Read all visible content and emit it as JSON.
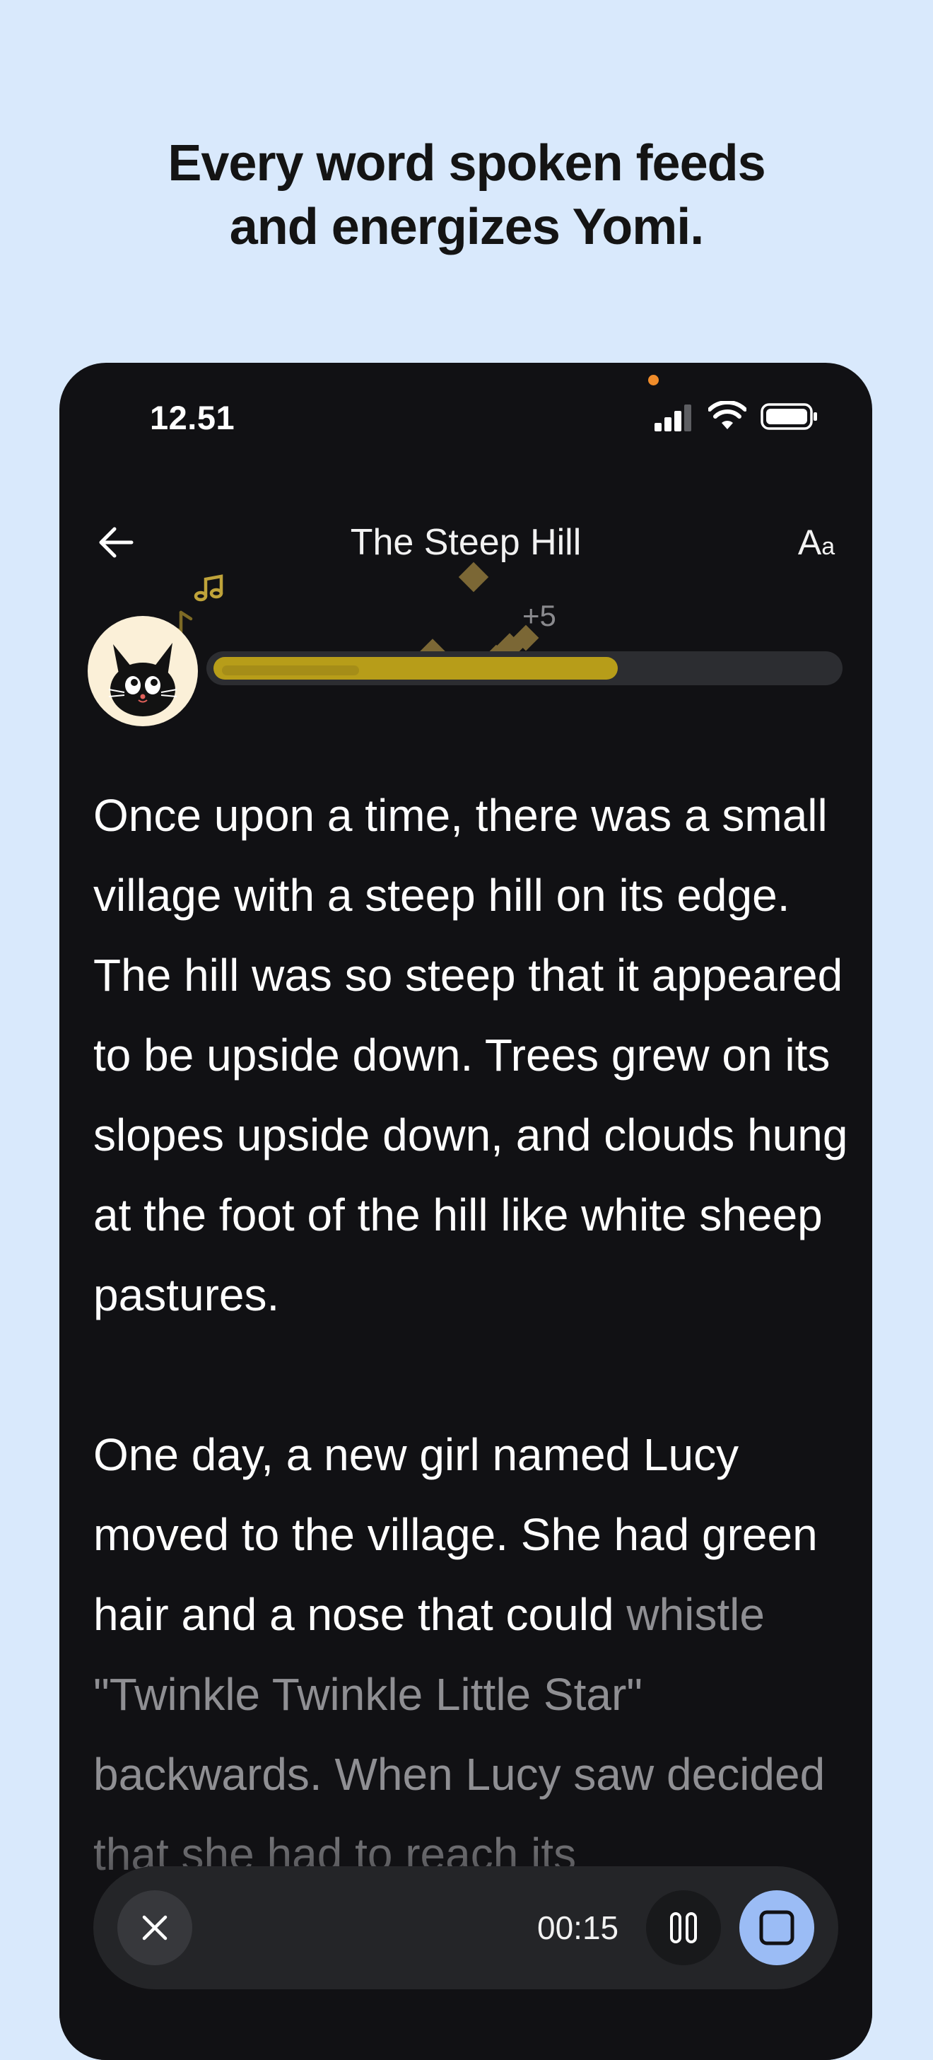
{
  "headline": {
    "line1": "Every word spoken feeds",
    "line2": "and energizes Yomi."
  },
  "status_bar": {
    "time": "12.51",
    "icons": [
      "cellular-signal-icon",
      "wifi-icon",
      "battery-icon"
    ]
  },
  "header": {
    "title": "The Steep Hill",
    "back_icon": "arrow-left-icon",
    "font_size_big": "A",
    "font_size_small": "a"
  },
  "energy": {
    "avatar": "black-cat-yomi",
    "points_label": "+5",
    "level": 0.65,
    "inner_level": 0.22,
    "fill_color": "#b79d19",
    "effects": [
      "music-note-icon",
      "music-note-icon",
      "diamond-particle-icon"
    ]
  },
  "story": {
    "paragraph1": "Once upon a time, there was a small village with a steep hill on its edge. The hill was so steep that it appeared to be upside down. Trees grew on its slopes upside down, and clouds hung at the foot of the hill like white sheep pastures.",
    "paragraph2_read": "One day, a new girl named Lucy moved to the village. She had green hair and a nose that could",
    "paragraph2_unread": "whistle \"Twinkle Twinkle Little Star\" backwards. When Lucy saw decided that she had to reach its"
  },
  "player": {
    "time": "00:15",
    "close_icon": "close-icon",
    "pause_icon": "pause-icon",
    "stop_icon": "stop-icon",
    "stop_color": "#9bbcf5"
  },
  "colors": {
    "page_background": "#d9e9fc",
    "phone_background": "#111114",
    "accent_gold": "#b79d19"
  }
}
